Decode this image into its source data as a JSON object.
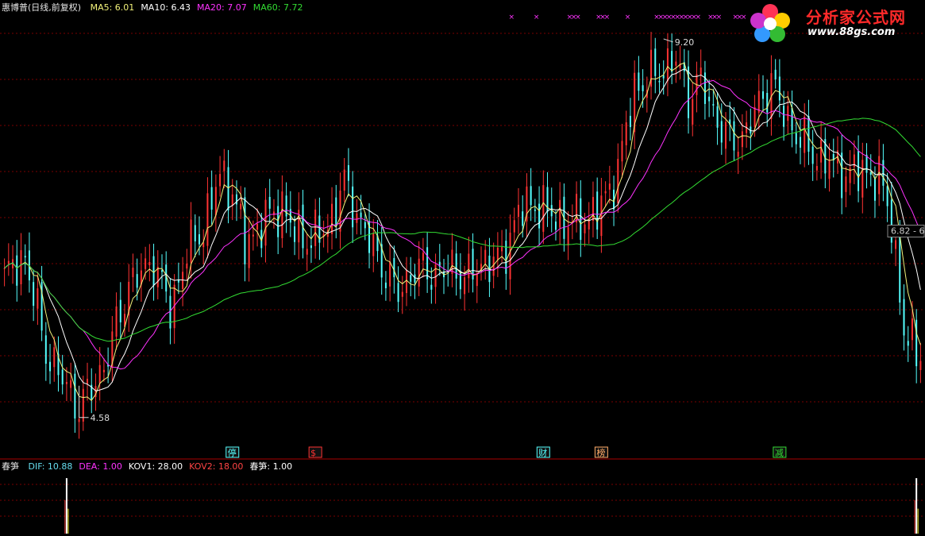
{
  "header": {
    "title": "惠博普(日线,前复权)",
    "ma": [
      {
        "label": "MA5",
        "value": "6.01",
        "color": "#f2f27a"
      },
      {
        "label": "MA10",
        "value": "6.43",
        "color": "#ffffff"
      },
      {
        "label": "MA20",
        "value": "7.07",
        "color": "#ff33ff"
      },
      {
        "label": "MA60",
        "value": "7.72",
        "color": "#33dd33"
      }
    ]
  },
  "indicator": {
    "name": "春笋",
    "values": [
      {
        "label": "DIF",
        "value": "10.88",
        "color": "#66ddee"
      },
      {
        "label": "DEA",
        "value": "1.00",
        "color": "#ff33ff"
      },
      {
        "label": "KOV1",
        "value": "28.00",
        "color": "#ffffff"
      },
      {
        "label": "KOV2",
        "value": "18.00",
        "color": "#ff4444"
      },
      {
        "label": "春笋",
        "value": "1.00",
        "color": "#ffffff"
      }
    ]
  },
  "logo": {
    "title": "分析家公式网",
    "url": "www.88gs.com"
  },
  "colors": {
    "background": "#000000",
    "up": "#ff3333",
    "down": "#55ffff",
    "grid": "#7a0000",
    "ma5": "#f2f27a",
    "ma10": "#ffffff",
    "ma20": "#ff33ff",
    "ma60": "#33dd33"
  },
  "chart_data": {
    "type": "candlestick",
    "ylim": [
      4.2,
      9.5
    ],
    "high_marker": {
      "value": "9.20",
      "index": 159
    },
    "low_marker": {
      "value": "4.58",
      "index": 18
    },
    "range_label": "6.82 - 6",
    "event_markers": [
      {
        "label": "停",
        "index": 55,
        "color": "#55ffff"
      },
      {
        "label": "$",
        "index": 75,
        "color": "#ff3333"
      },
      {
        "label": "财",
        "index": 130,
        "color": "#55ffff"
      },
      {
        "label": "榜",
        "index": 144,
        "color": "#ffaa66"
      },
      {
        "label": "减",
        "index": 187,
        "color": "#33dd33"
      }
    ],
    "top_marker_indices": [
      122,
      128,
      136,
      137,
      138,
      143,
      144,
      145,
      150,
      157,
      158,
      159,
      160,
      161,
      162,
      163,
      164,
      165,
      166,
      167,
      170,
      171,
      172,
      176,
      177,
      178,
      181
    ],
    "anchors": [
      [
        0,
        6.3
      ],
      [
        5,
        6.55
      ],
      [
        10,
        5.4
      ],
      [
        18,
        4.7
      ],
      [
        24,
        5.2
      ],
      [
        30,
        6.2
      ],
      [
        36,
        6.5
      ],
      [
        40,
        5.9
      ],
      [
        44,
        6.6
      ],
      [
        48,
        6.9
      ],
      [
        52,
        7.55
      ],
      [
        55,
        7.35
      ],
      [
        58,
        6.7
      ],
      [
        63,
        7.0
      ],
      [
        67,
        7.15
      ],
      [
        70,
        6.85
      ],
      [
        74,
        6.75
      ],
      [
        78,
        6.9
      ],
      [
        82,
        7.45
      ],
      [
        86,
        6.95
      ],
      [
        91,
        6.45
      ],
      [
        95,
        6.1
      ],
      [
        99,
        6.4
      ],
      [
        104,
        6.35
      ],
      [
        108,
        6.4
      ],
      [
        112,
        6.3
      ],
      [
        116,
        6.5
      ],
      [
        120,
        6.5
      ],
      [
        124,
        7.1
      ],
      [
        128,
        7.2
      ],
      [
        132,
        7.05
      ],
      [
        136,
        6.95
      ],
      [
        140,
        7.0
      ],
      [
        144,
        7.15
      ],
      [
        148,
        7.6
      ],
      [
        152,
        8.6
      ],
      [
        155,
        8.7
      ],
      [
        159,
        8.85
      ],
      [
        162,
        8.95
      ],
      [
        165,
        8.5
      ],
      [
        168,
        8.7
      ],
      [
        171,
        8.3
      ],
      [
        175,
        7.95
      ],
      [
        178,
        8.0
      ],
      [
        182,
        8.4
      ],
      [
        185,
        8.7
      ],
      [
        188,
        8.3
      ],
      [
        191,
        8.05
      ],
      [
        195,
        7.8
      ],
      [
        199,
        7.7
      ],
      [
        203,
        7.55
      ],
      [
        207,
        7.6
      ],
      [
        211,
        7.5
      ],
      [
        214,
        7.0
      ],
      [
        217,
        5.6
      ],
      [
        220,
        5.4
      ]
    ],
    "indicator_spikes": [
      {
        "index": 15,
        "value": 10.88
      },
      {
        "index": 220,
        "value": 10.88
      }
    ],
    "indicator_ylim": [
      0,
      12
    ]
  }
}
